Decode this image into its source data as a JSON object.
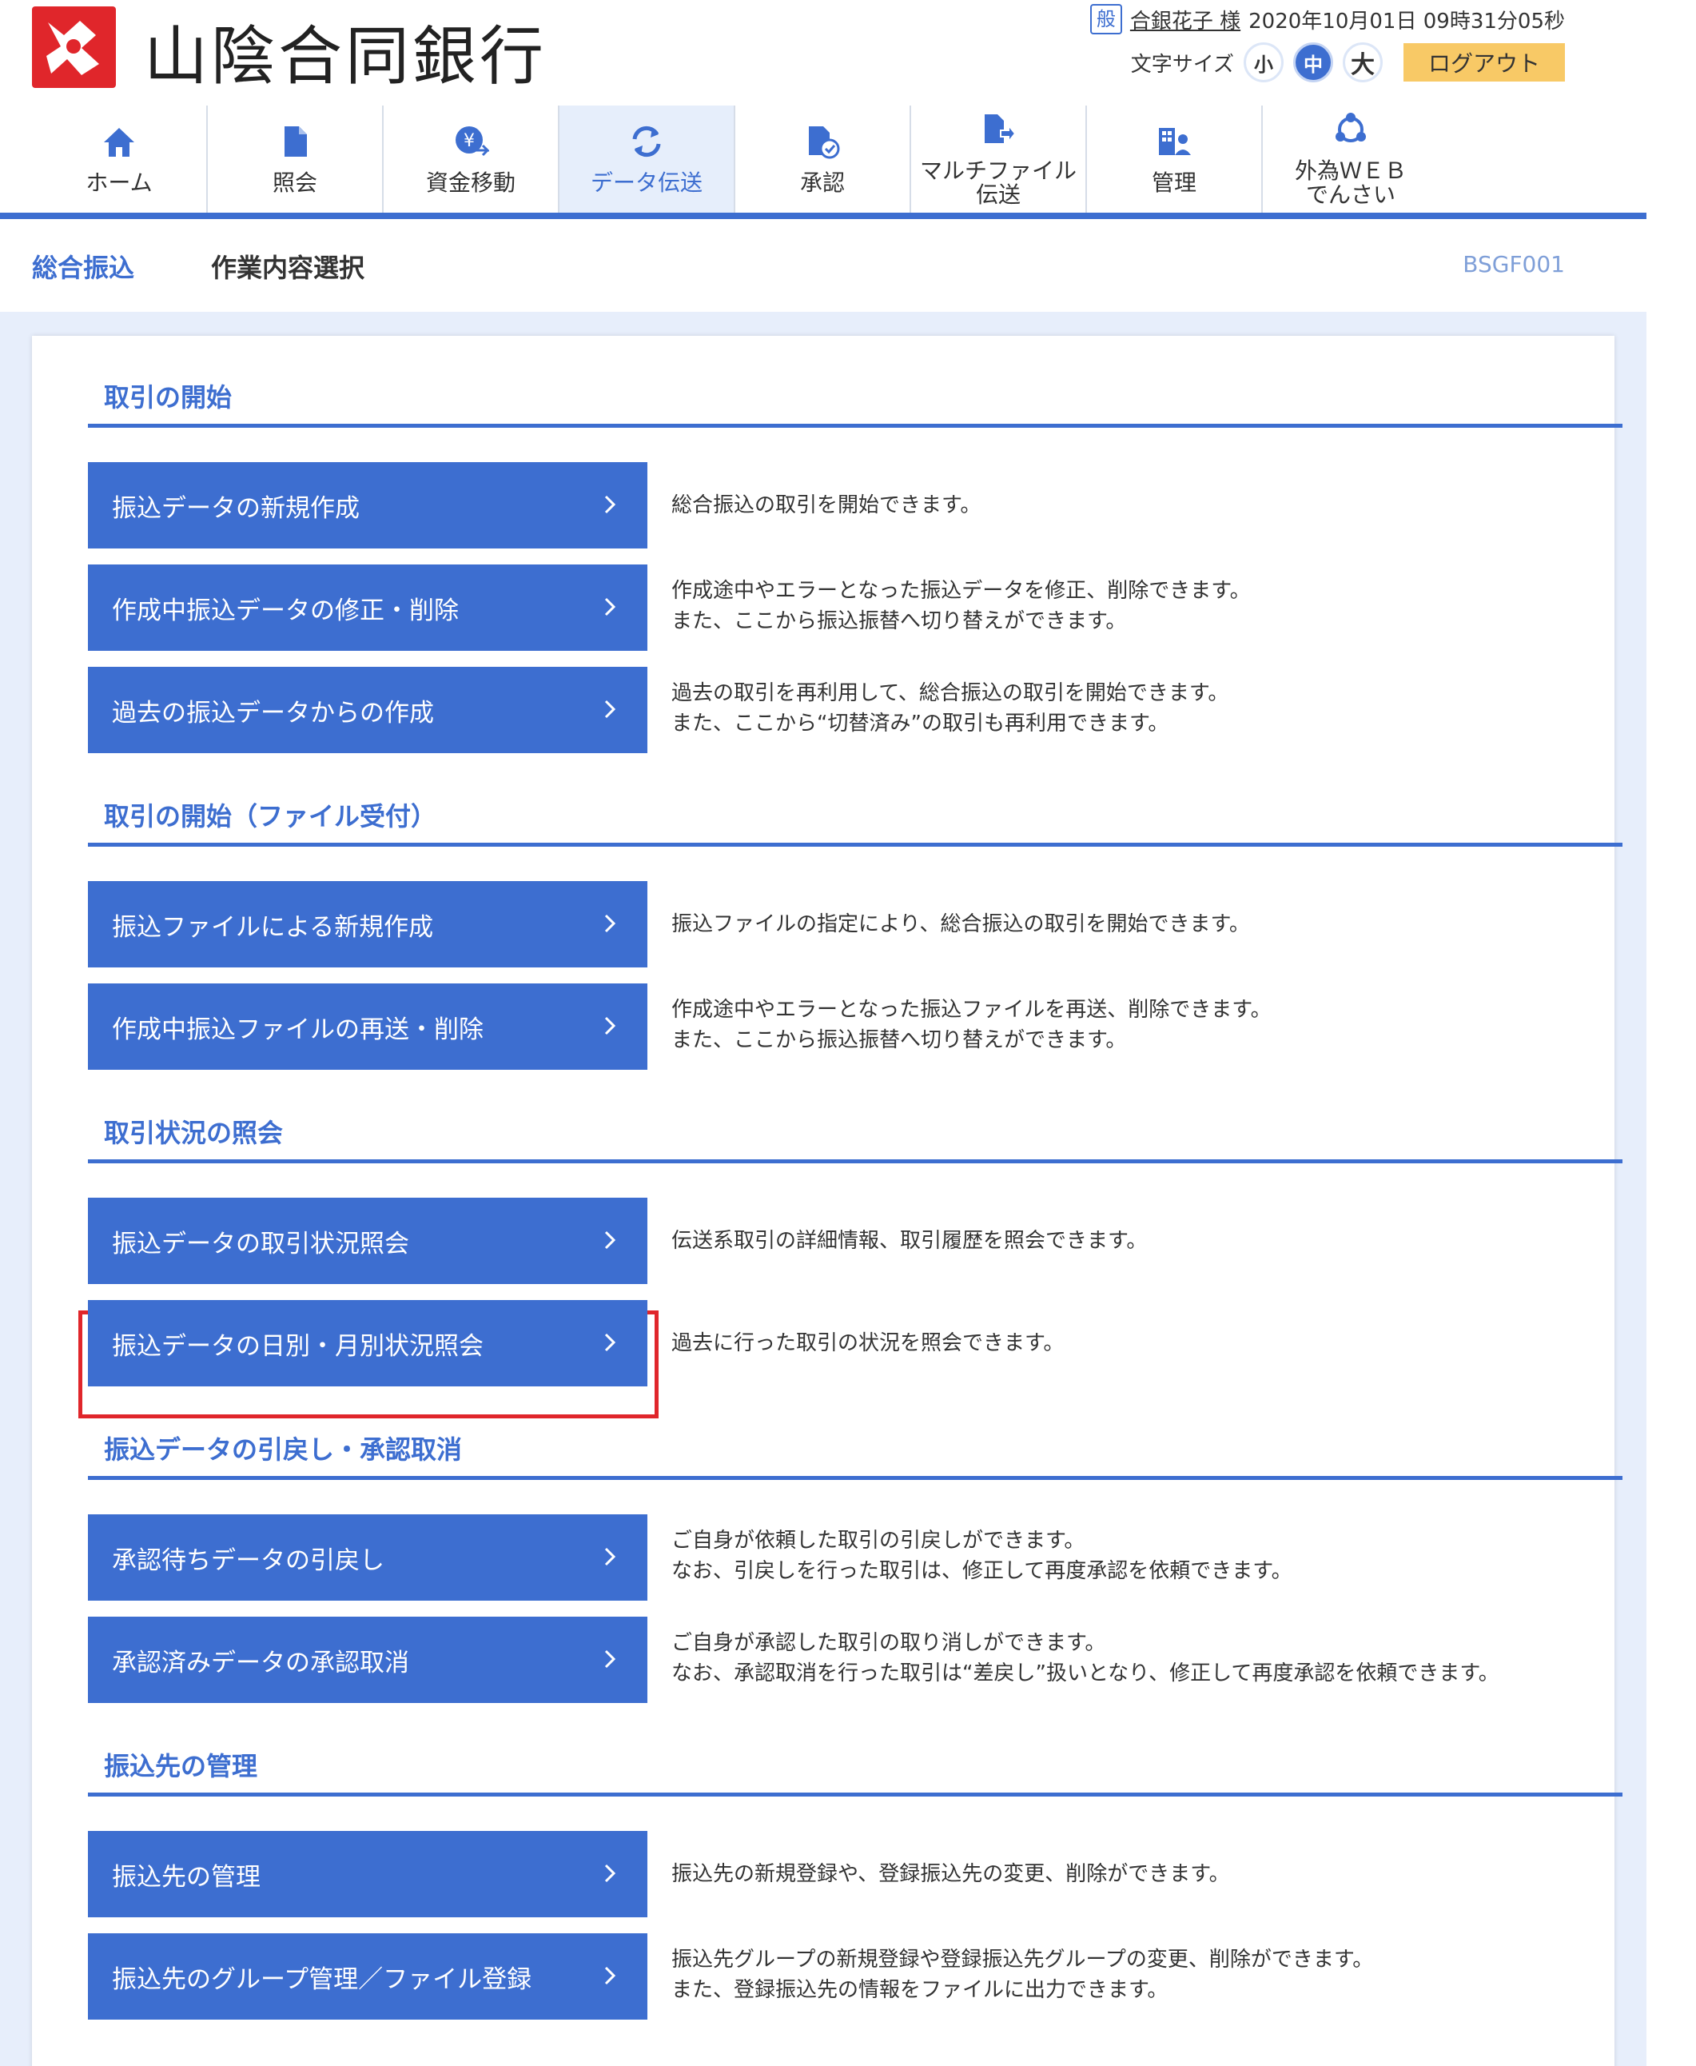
{
  "bank": {
    "name": "山陰合同銀行"
  },
  "user": {
    "badge": "般",
    "name": "合銀花子 様",
    "datetime": "2020年10月01日 09時31分05秒"
  },
  "font_size": {
    "label": "文字サイズ",
    "small": "小",
    "medium": "中",
    "large": "大"
  },
  "logout_label": "ログアウト",
  "nav": {
    "items": [
      {
        "label": "ホーム",
        "icon": "home-icon"
      },
      {
        "label": "照会",
        "icon": "document-icon"
      },
      {
        "label": "資金移動",
        "icon": "yen-transfer-icon"
      },
      {
        "label": "データ伝送",
        "icon": "refresh-icon"
      },
      {
        "label": "承認",
        "icon": "approve-icon"
      },
      {
        "label": "マルチファイル\n伝送",
        "icon": "multi-file-icon"
      },
      {
        "label": "管理",
        "icon": "manage-icon"
      },
      {
        "label": "外為ＷＥＢ\nでんさい",
        "icon": "network-icon"
      }
    ]
  },
  "breadcrumb": "総合振込",
  "page_title": "作業内容選択",
  "screen_id": "BSGF001",
  "sections": [
    {
      "title": "取引の開始",
      "actions": [
        {
          "label": "振込データの新規作成",
          "desc1": "総合振込の取引を開始できます。",
          "desc2": ""
        },
        {
          "label": "作成中振込データの修正・削除",
          "desc1": "作成途中やエラーとなった振込データを修正、削除できます。",
          "desc2": "また、ここから振込振替へ切り替えができます。"
        },
        {
          "label": "過去の振込データからの作成",
          "desc1": "過去の取引を再利用して、総合振込の取引を開始できます。",
          "desc2": "また、ここから“切替済み”の取引も再利用できます。"
        }
      ]
    },
    {
      "title": "取引の開始（ファイル受付）",
      "actions": [
        {
          "label": "振込ファイルによる新規作成",
          "desc1": "振込ファイルの指定により、総合振込の取引を開始できます。",
          "desc2": ""
        },
        {
          "label": "作成中振込ファイルの再送・削除",
          "desc1": "作成途中やエラーとなった振込ファイルを再送、削除できます。",
          "desc2": "また、ここから振込振替へ切り替えができます。"
        }
      ]
    },
    {
      "title": "取引状況の照会",
      "actions": [
        {
          "label": "振込データの取引状況照会",
          "desc1": "伝送系取引の詳細情報、取引履歴を照会できます。",
          "desc2": ""
        },
        {
          "label": "振込データの日別・月別状況照会",
          "desc1": "過去に行った取引の状況を照会できます。",
          "desc2": ""
        }
      ]
    },
    {
      "title": "振込データの引戻し・承認取消",
      "actions": [
        {
          "label": "承認待ちデータの引戻し",
          "desc1": "ご自身が依頼した取引の引戻しができます。",
          "desc2": "なお、引戻しを行った取引は、修正して再度承認を依頼できます。"
        },
        {
          "label": "承認済みデータの承認取消",
          "desc1": "ご自身が承認した取引の取り消しができます。",
          "desc2": "なお、承認取消を行った取引は“差戻し”扱いとなり、修正して再度承認を依頼できます。"
        }
      ]
    },
    {
      "title": "振込先の管理",
      "actions": [
        {
          "label": "振込先の管理",
          "desc1": "振込先の新規登録や、登録振込先の変更、削除ができます。",
          "desc2": ""
        },
        {
          "label": "振込先のグループ管理／ファイル登録",
          "desc1": "振込先グループの新規登録や登録振込先グループの変更、削除ができます。",
          "desc2": "また、登録振込先の情報をファイルに出力できます。"
        }
      ]
    }
  ],
  "colors": {
    "accent": "#3d6ed0",
    "logout": "#f8c966",
    "brand_red": "#e0262b",
    "highlight": "#e0262b"
  }
}
